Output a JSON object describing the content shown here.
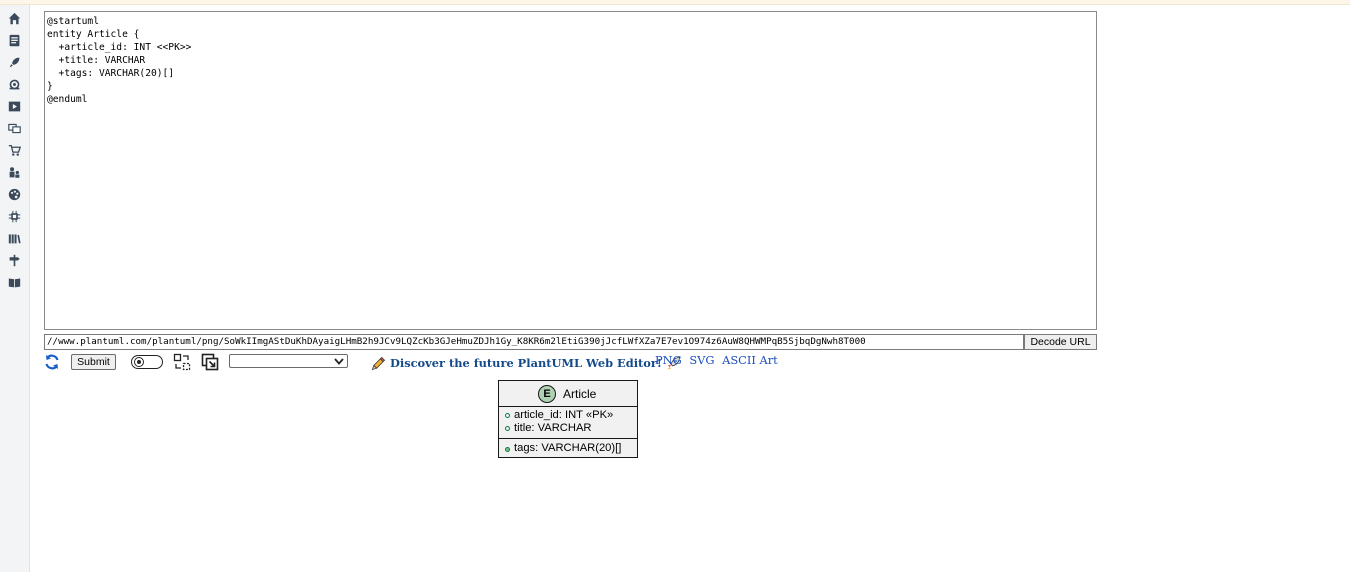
{
  "editor": {
    "source": "@startuml\nentity Article {\n  +article_id: INT <<PK>>\n  +title: VARCHAR\n  +tags: VARCHAR(20)[]\n}\n@enduml"
  },
  "url_bar": {
    "value": "//www.plantuml.com/plantuml/png/SoWkIImgAStDuKhDAyaigLHmB2h9JCv9LQZcKb3GJeHmuZDJh1Gy_K8KR6m2lEtiG390jJcfLWfXZa7E7ev1O974z6AuW8QHWMPqB5SjbqDgNwh8T000",
    "decode_label": "Decode URL"
  },
  "toolbar": {
    "submit_label": "Submit",
    "select_value": "",
    "discover_label": "Discover the future PlantUML Web Editor!",
    "format_png": "PNG",
    "format_svg": "SVG",
    "format_ascii": "ASCII Art"
  },
  "sidebar": {
    "icons": [
      "home-icon",
      "document-icon",
      "rocket-icon",
      "cloud-gear-icon",
      "play-icon",
      "chat-icon",
      "cart-icon",
      "people-icon",
      "palette-icon",
      "chip-icon",
      "library-icon",
      "signpost-icon",
      "book-icon"
    ]
  },
  "diagram": {
    "entity_letter": "E",
    "entity_name": "Article",
    "attributes": [
      "article_id: INT «PK»",
      "title: VARCHAR",
      "tags: VARCHAR(20)[]"
    ]
  },
  "colors": {
    "link": "#154a8a",
    "format_link": "#1a4fbf",
    "entity_badge": "#ADD1B2",
    "entity_bg": "#F1F1F1"
  }
}
